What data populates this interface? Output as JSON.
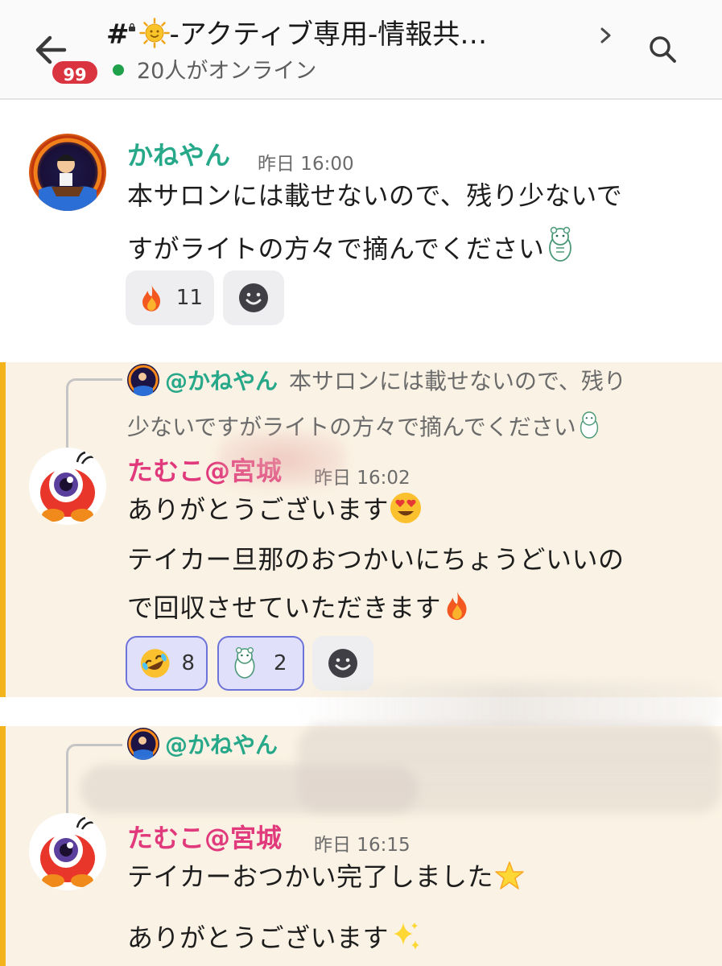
{
  "header": {
    "badge_count": "99",
    "channel_prefix": "#",
    "channel_title": "-アクティブ専用-情報共…",
    "online_status": "20人がオンライン"
  },
  "messages": [
    {
      "username": "かねやん",
      "timestamp": "昨日 16:00",
      "lines": [
        "本サロンには載せないので、残り少ないで",
        "すがライトの方々で摘んでください"
      ],
      "reactions": [
        {
          "emoji": "fire",
          "count": "11"
        }
      ]
    },
    {
      "reply_mention": "@かねやん",
      "reply_lines": [
        "本サロンには載せないので、残り",
        "少ないですがライトの方々で摘んでください"
      ],
      "username": "たむこ@宮城",
      "timestamp": "昨日 16:02",
      "lines": [
        "ありがとうございます",
        "テイカー旦那のおつかいにちょうどいいの",
        "で回収させていただきます"
      ],
      "reactions": [
        {
          "emoji": "rofl",
          "count": "8"
        },
        {
          "emoji": "bear-sticker",
          "count": "2"
        }
      ]
    },
    {
      "reply_mention": "@かねやん",
      "username": "たむこ@宮城",
      "timestamp": "昨日 16:15",
      "lines": [
        "テイカーおつかい完了しました",
        "ありがとうございます"
      ]
    }
  ],
  "colors": {
    "header_bg": "#fafafa",
    "badge": "#d9343f",
    "online_dot": "#1fa04a",
    "kaneyan_name": "#27a889",
    "tamuko_name": "#e13a7c",
    "thread_bg": "#faf2e4",
    "thread_accent": "#f3b31b",
    "my_reaction_border": "#6e73d8"
  }
}
